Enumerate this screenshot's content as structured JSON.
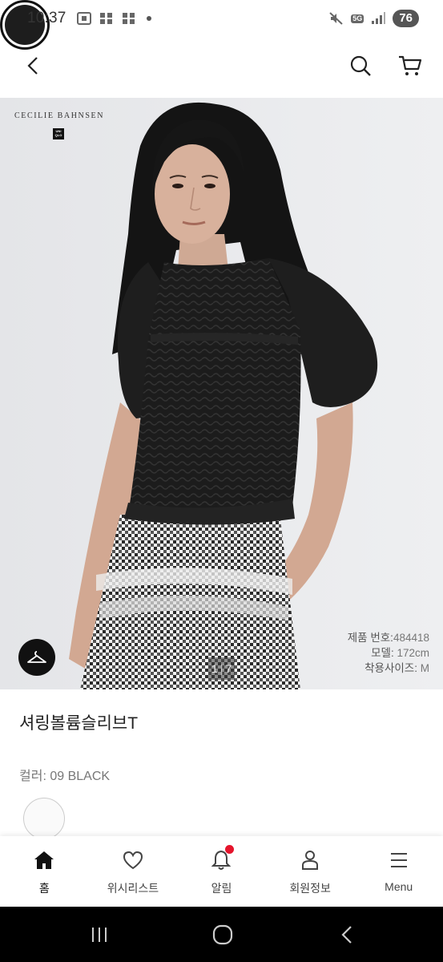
{
  "status_bar": {
    "time": "10:37",
    "network": "5G",
    "battery": "76"
  },
  "header": {
    "back_icon": "chevron-left-icon",
    "search_icon": "search-icon",
    "cart_icon": "cart-icon"
  },
  "hero": {
    "brand_text": "CECILIE BAHNSEN",
    "logo_text": "UNI QLO",
    "image_index": "1",
    "image_total": "7",
    "product_no_label": "제품 번호:",
    "product_no_value": "484418",
    "model_label": "모델:",
    "model_value": "172cm",
    "size_label": "착용사이즈:",
    "size_value": "M"
  },
  "product": {
    "name": "셔링볼륨슬리브T",
    "color_label": "컬러: 09 BLACK",
    "swatches": [
      "white",
      "black"
    ]
  },
  "bottom_nav": {
    "items": [
      {
        "label": "홈",
        "icon": "home-icon"
      },
      {
        "label": "위시리스트",
        "icon": "heart-icon"
      },
      {
        "label": "알림",
        "icon": "bell-icon"
      },
      {
        "label": "회원정보",
        "icon": "user-icon"
      },
      {
        "label": "Menu",
        "icon": "menu-icon"
      }
    ]
  },
  "colors": {
    "accent_red": "#e5142c",
    "black": "#111111",
    "muted": "#777777"
  }
}
